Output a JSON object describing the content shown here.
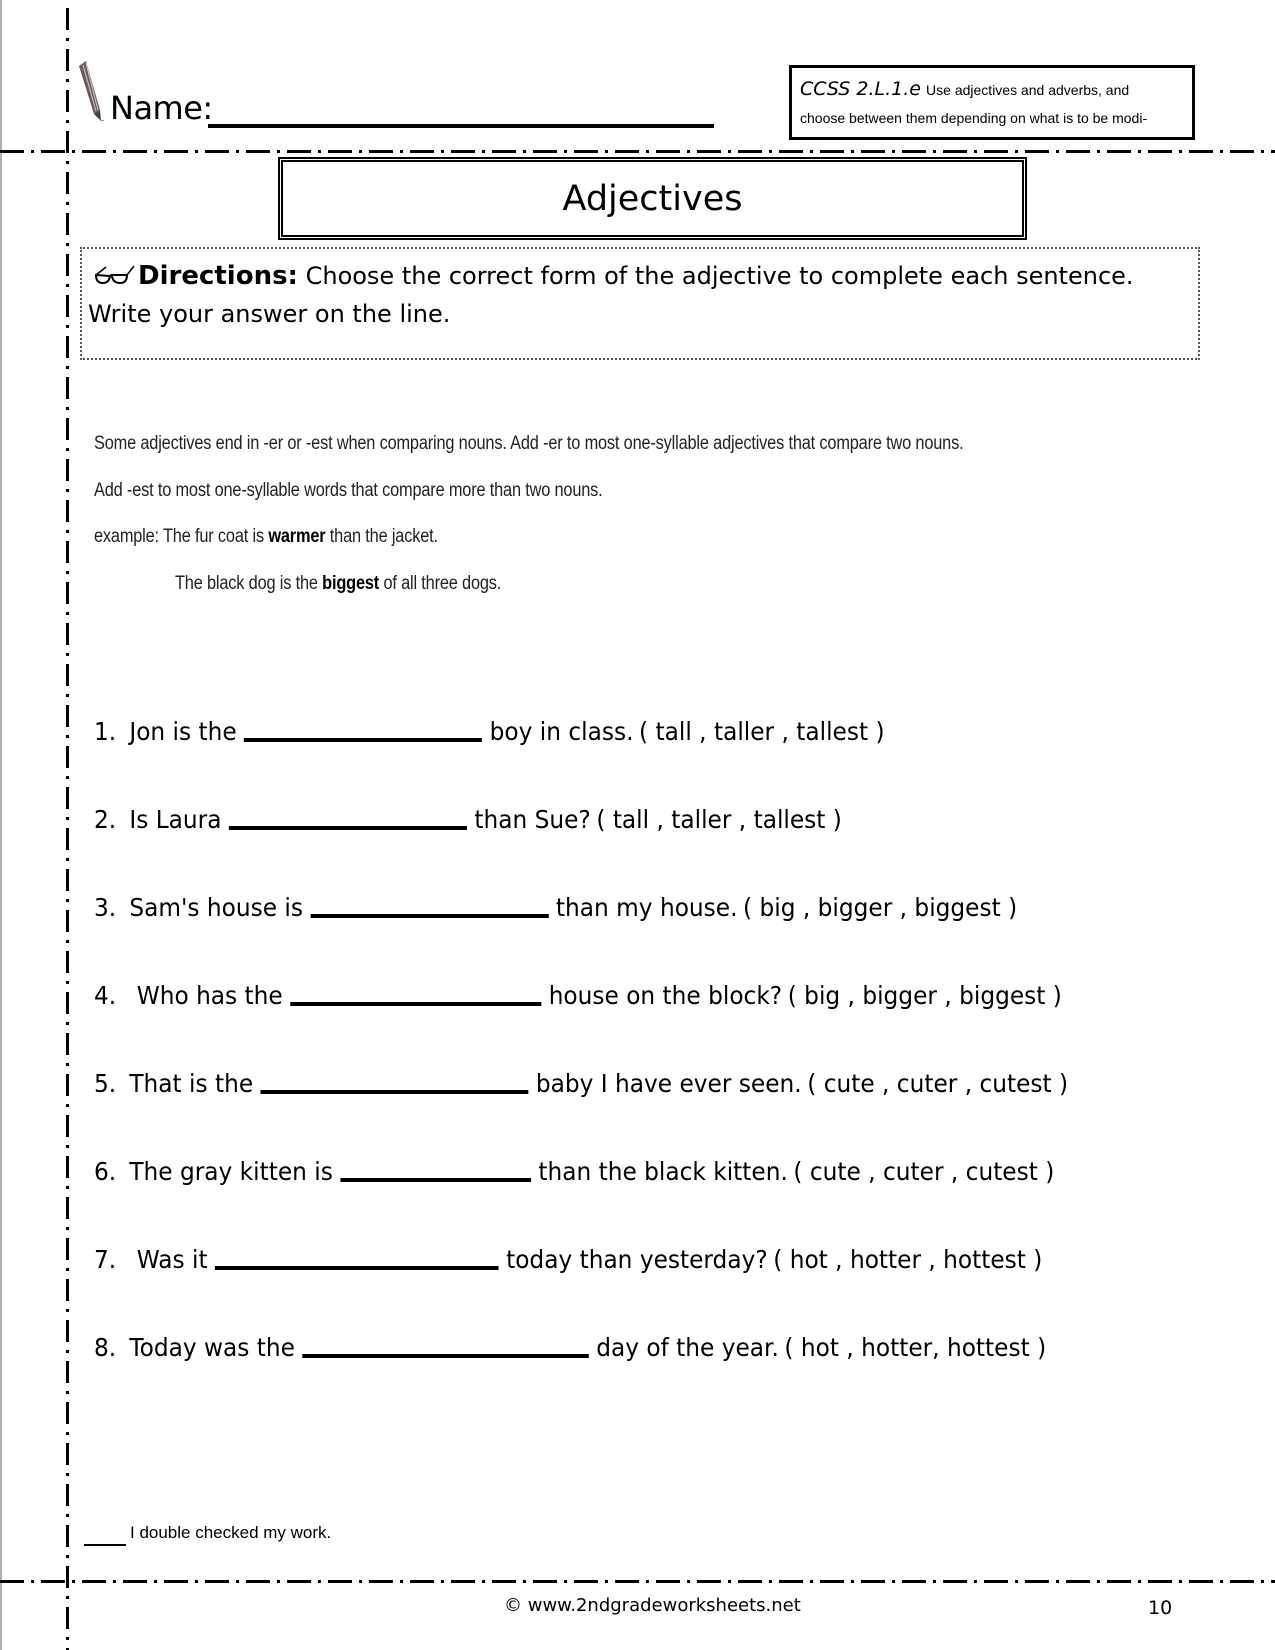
{
  "header": {
    "name_label": "Name:",
    "ccss_code": "CCSS 2.L.1.e",
    "ccss_text_line1": "Use adjectives and adverbs, and",
    "ccss_text_line2": "choose between them depending on what is to be modi-"
  },
  "title": "Adjectives",
  "directions": {
    "label": "Directions:",
    "text_line1": "Choose the correct form of the adjective to complete each sentence.",
    "text_line2": "Write your answer on the line."
  },
  "explanation": {
    "line1": "Some adjectives end in -er or -est when comparing nouns.  Add -er to most one-syllable adjectives that compare two nouns.",
    "line2": "Add -est to most one-syllable words that compare more than two nouns.",
    "example1": {
      "prefix": "example: The fur coat is ",
      "bold": "warmer",
      "suffix": " than the jacket."
    },
    "example2": {
      "prefix": "The black dog is the ",
      "bold": "biggest",
      "suffix": " of all three dogs."
    }
  },
  "questions": [
    {
      "num": "1.",
      "before": "Jon is the",
      "after": "boy in class.",
      "options": "( tall , taller , tallest )",
      "answer": ""
    },
    {
      "num": "2.",
      "before": "Is Laura",
      "after": "than Sue?",
      "options": "( tall , taller , tallest )",
      "answer": ""
    },
    {
      "num": "3.",
      "before": "Sam's house is",
      "after": "than my house.",
      "options": "( big , bigger , biggest )",
      "answer": ""
    },
    {
      "num": "4.",
      "before": " Who has the",
      "after": "house on the block?",
      "options": "( big , bigger , biggest )",
      "answer": ""
    },
    {
      "num": "5.",
      "before": "That is the",
      "after": "baby I have ever seen.",
      "options": "( cute , cuter , cutest )",
      "answer": ""
    },
    {
      "num": "6.",
      "before": "The gray kitten is",
      "after": "than the black kitten.",
      "options": "( cute , cuter , cutest )",
      "answer": ""
    },
    {
      "num": "7.",
      "before": " Was it",
      "after": "today than yesterday?",
      "options": "( hot , hotter , hottest )",
      "answer": ""
    },
    {
      "num": "8.",
      "before": "Today was the",
      "after": "day of the year.",
      "options": "( hot , hotter, hottest )",
      "answer": ""
    }
  ],
  "footer": {
    "check_text": "I double checked my work.",
    "copyright": "© www.2ndgradeworksheets.net",
    "page_number": "10"
  }
}
